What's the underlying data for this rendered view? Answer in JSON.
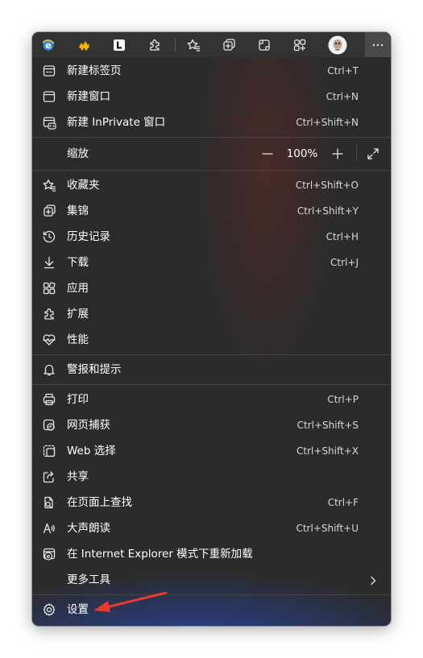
{
  "menu": {
    "items": [
      {
        "label": "新建标签页",
        "shortcut": "Ctrl+T"
      },
      {
        "label": "新建窗口",
        "shortcut": "Ctrl+N"
      },
      {
        "label": "新建 InPrivate 窗口",
        "shortcut": "Ctrl+Shift+N"
      },
      {
        "label": "收藏夹",
        "shortcut": "Ctrl+Shift+O"
      },
      {
        "label": "集锦",
        "shortcut": "Ctrl+Shift+Y"
      },
      {
        "label": "历史记录",
        "shortcut": "Ctrl+H"
      },
      {
        "label": "下载",
        "shortcut": "Ctrl+J"
      },
      {
        "label": "应用",
        "shortcut": ""
      },
      {
        "label": "扩展",
        "shortcut": ""
      },
      {
        "label": "性能",
        "shortcut": ""
      },
      {
        "label": "警报和提示",
        "shortcut": ""
      },
      {
        "label": "打印",
        "shortcut": "Ctrl+P"
      },
      {
        "label": "网页捕获",
        "shortcut": "Ctrl+Shift+S"
      },
      {
        "label": "Web 选择",
        "shortcut": "Ctrl+Shift+X"
      },
      {
        "label": "共享",
        "shortcut": ""
      },
      {
        "label": "在页面上查找",
        "shortcut": "Ctrl+F"
      },
      {
        "label": "大声朗读",
        "shortcut": "Ctrl+Shift+U"
      },
      {
        "label": "在 Internet Explorer 模式下重新加载",
        "shortcut": ""
      },
      {
        "label": "更多工具",
        "shortcut": ""
      },
      {
        "label": "设置",
        "shortcut": ""
      }
    ],
    "zoom": {
      "label": "缩放",
      "value": "100%",
      "minus": "—",
      "plus": "+"
    }
  },
  "colors": {
    "menu_bg": "#2b2b2b",
    "toolbar_bg": "#333333",
    "divider": "#454545",
    "annotation_arrow": "#e8392f",
    "bottom_glow": "#2846aa"
  }
}
